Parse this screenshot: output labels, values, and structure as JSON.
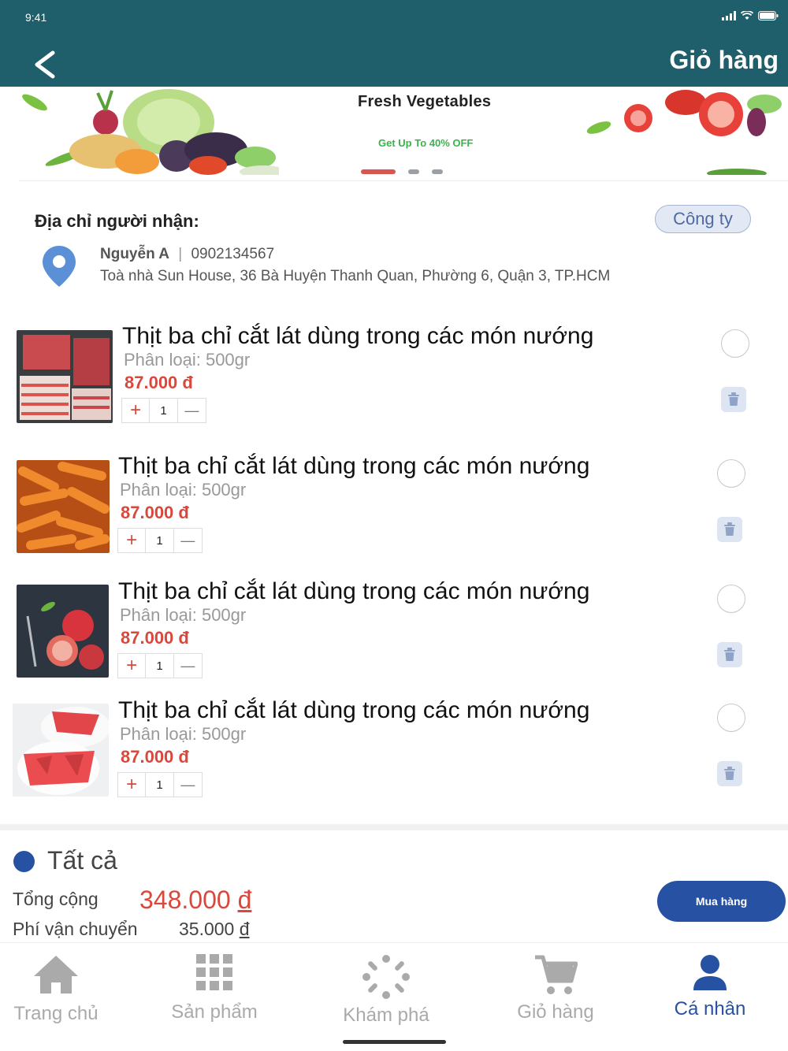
{
  "status_bar": {
    "time": "9:41"
  },
  "header": {
    "title": "Giỏ hàng"
  },
  "banner": {
    "title": "Fresh Vegetables",
    "subtitle": "Get Up To 40% OFF",
    "slide_count": 3,
    "active_slide": 1
  },
  "address": {
    "heading": "Địa chỉ người nhận:",
    "tag": "Công ty",
    "name": "Nguyễn A",
    "separator": "|",
    "phone": "0902134567",
    "detail": "Toà nhà Sun House, 36 Bà Huyện Thanh Quan, Phường 6, Quận 3, TP.HCM"
  },
  "cart": {
    "items": [
      {
        "title": "Thịt ba chỉ cắt lát dùng trong các món nướng",
        "variant": "Phân loại: 500gr",
        "price": "87.000 đ",
        "qty": "1",
        "plus": "+",
        "minus": "—",
        "image": "meat"
      },
      {
        "title": "Thịt ba chỉ cắt lát dùng trong các món nướng",
        "variant": "Phân loại: 500gr",
        "price": "87.000 đ",
        "qty": "1",
        "plus": "+",
        "minus": "—",
        "image": "carrots"
      },
      {
        "title": "Thịt ba chỉ cắt lát dùng trong các món nướng",
        "variant": "Phân loại: 500gr",
        "price": "87.000 đ",
        "qty": "1",
        "plus": "+",
        "minus": "—",
        "image": "pomegranate"
      },
      {
        "title": "Thịt ba chỉ cắt lát dùng trong các món nướng",
        "variant": "Phân loại: 500gr",
        "price": "87.000 đ",
        "qty": "1",
        "plus": "+",
        "minus": "—",
        "image": "watermelon"
      }
    ]
  },
  "summary": {
    "select_all": "Tất cả",
    "total_label": "Tổng cộng",
    "total_value": "348.000",
    "total_currency": "đ",
    "shipping_label": "Phí vận chuyển",
    "shipping_value": "35.000",
    "shipping_currency": "đ",
    "buy_button": "Mua hàng"
  },
  "tabbar": {
    "tabs": [
      {
        "label": "Trang chủ",
        "icon": "home-icon"
      },
      {
        "label": "Sản phẩm",
        "icon": "grid-icon"
      },
      {
        "label": "Khám phá",
        "icon": "explore-icon"
      },
      {
        "label": "Giỏ hàng",
        "icon": "cart-icon"
      },
      {
        "label": "Cá nhân",
        "icon": "person-icon"
      }
    ],
    "active": "Cá nhân"
  },
  "colors": {
    "header_bg": "#1f5f6b",
    "accent_blue": "#2751a3",
    "price_red": "#d9483b",
    "banner_green": "#3ab34a"
  }
}
